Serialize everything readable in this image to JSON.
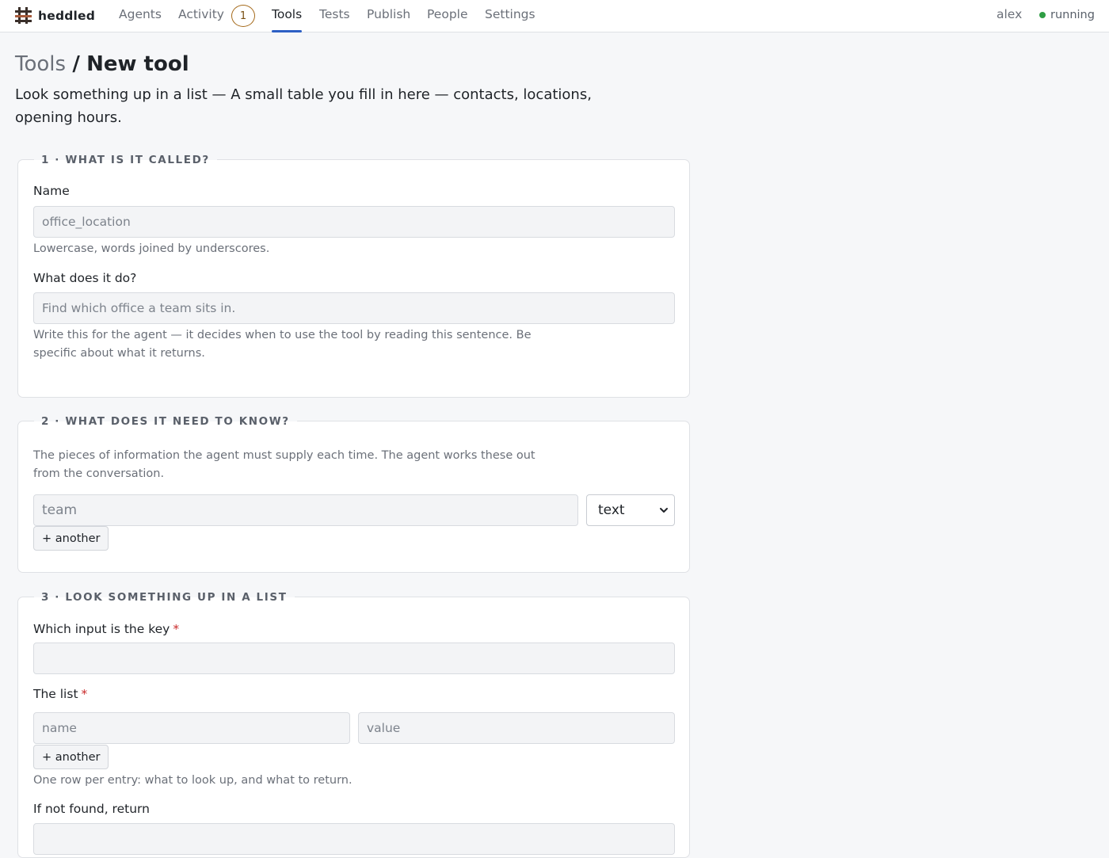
{
  "brand": {
    "name": "heddled",
    "icon": "hash-grid-icon"
  },
  "nav": {
    "items": [
      "Agents",
      "Activity",
      "Tools",
      "Tests",
      "Publish",
      "People",
      "Settings"
    ],
    "active": "Tools",
    "activity_badge": "1"
  },
  "user": {
    "name": "alex",
    "status": "running",
    "status_color": "#2f9e44"
  },
  "breadcrumb": {
    "parent": "Tools",
    "separator": "/",
    "current": "New tool"
  },
  "subtitle": "Look something up in a list — A small table you fill in here — contacts, locations, opening hours.",
  "section1": {
    "legend": "1 · WHAT IS IT CALLED?",
    "name_label": "Name",
    "name_placeholder": "office_location",
    "name_hint": "Lowercase, words joined by underscores.",
    "desc_label": "What does it do?",
    "desc_placeholder": "Find which office a team sits in.",
    "desc_hint": "Write this for the agent — it decides when to use the tool by reading this sentence. Be specific about what it returns."
  },
  "section2": {
    "legend": "2 · WHAT DOES IT NEED TO KNOW?",
    "intro": "The pieces of information the agent must supply each time. The agent works these out from the conversation.",
    "input_placeholder": "team",
    "type_value": "text",
    "add_label": "+ another"
  },
  "section3": {
    "legend": "3 · LOOK SOMETHING UP IN A LIST",
    "key_label": "Which input is the key",
    "required_mark": "*",
    "key_value": "",
    "list_label": "The list",
    "name_placeholder": "name",
    "value_placeholder": "value",
    "add_label": "+ another",
    "list_hint": "One row per entry: what to look up, and what to return.",
    "notfound_label": "If not found, return",
    "notfound_value": ""
  },
  "colors": {
    "accent": "#2d5fc4",
    "badge": "#a56a1b",
    "required": "#c92a2a"
  }
}
